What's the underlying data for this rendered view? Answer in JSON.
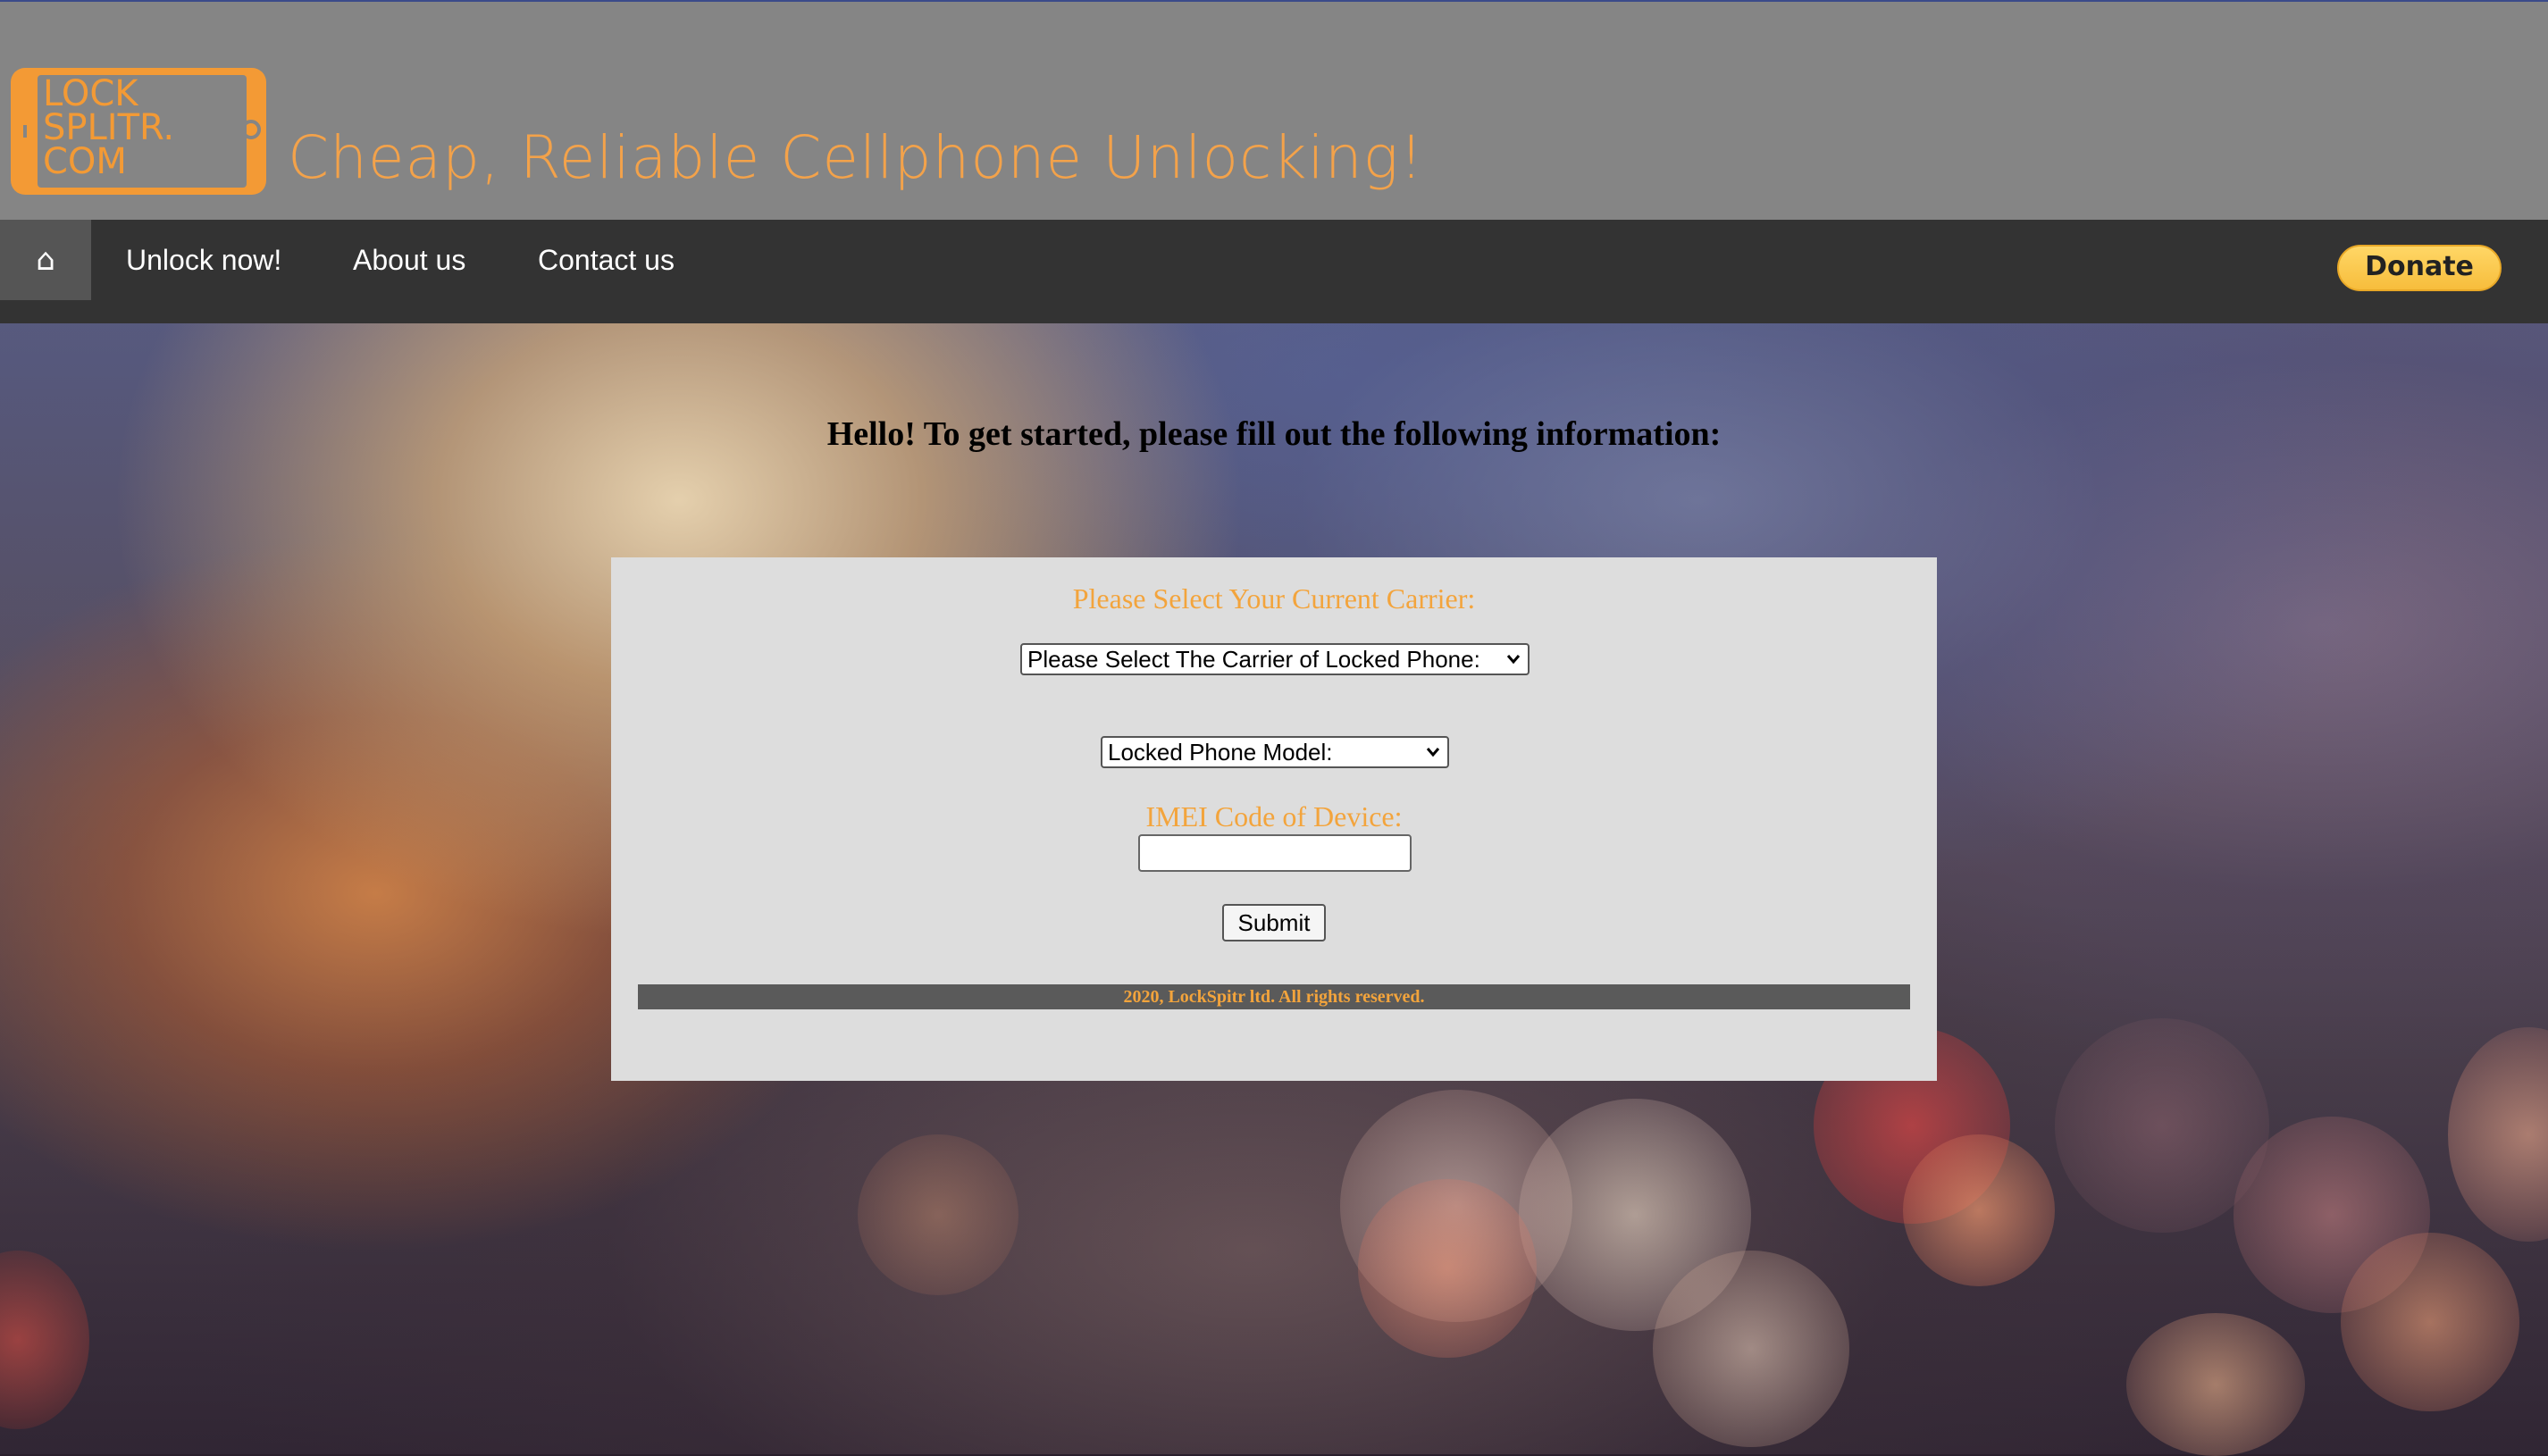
{
  "header": {
    "logo_text": "LOCK\nSPLITR.\nCOM",
    "tagline": "Cheap, Reliable Cellphone Unlocking!"
  },
  "nav": {
    "home_icon": "⌂",
    "items": [
      {
        "label": "Unlock now!"
      },
      {
        "label": "About us"
      },
      {
        "label": "Contact us"
      }
    ],
    "donate_label": "Donate"
  },
  "main": {
    "greeting": "Hello! To get started, please fill out the following information:",
    "form": {
      "carrier_label": "Please Select Your Current Carrier:",
      "carrier_select_value": "Please Select The Carrier of Locked Phone:",
      "model_select_value": "Locked Phone Model:",
      "imei_label": "IMEI Code of Device:",
      "imei_value": "",
      "submit_label": "Submit"
    },
    "footer": "2020, LockSpitr ltd. All rights reserved."
  },
  "colors": {
    "accent": "#f39a35",
    "header_bg": "#858585",
    "nav_bg": "#333333",
    "panel_bg": "#dddddd"
  }
}
